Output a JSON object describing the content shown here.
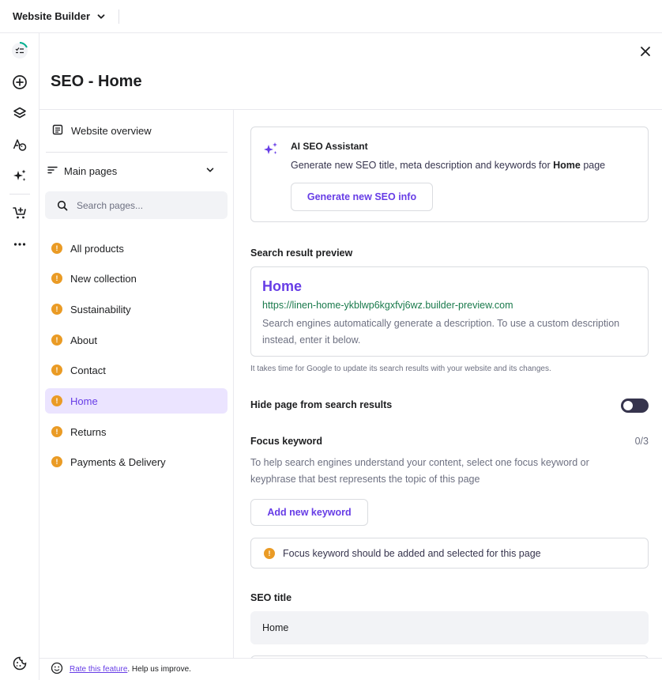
{
  "app": {
    "title": "Website Builder"
  },
  "rail": {
    "icons": [
      "checklist-progress-icon",
      "add-element-icon",
      "layers-icon",
      "typography-color-icon",
      "ai-tools-icon",
      "store-cart-icon",
      "more-icon",
      "cookie-settings-icon"
    ]
  },
  "panel": {
    "title": "SEO - Home",
    "close_icon": "close-icon"
  },
  "pages_nav": {
    "overview_label": "Website overview",
    "group_label": "Main pages",
    "search_placeholder": "Search pages...",
    "items": [
      {
        "label": "All products",
        "status": "warning"
      },
      {
        "label": "New collection",
        "status": "warning"
      },
      {
        "label": "Sustainability",
        "status": "warning"
      },
      {
        "label": "About",
        "status": "warning"
      },
      {
        "label": "Contact",
        "status": "warning"
      },
      {
        "label": "Home",
        "status": "warning",
        "active": true
      },
      {
        "label": "Returns",
        "status": "warning"
      },
      {
        "label": "Payments & Delivery",
        "status": "warning"
      }
    ],
    "warning_glyph": "!"
  },
  "ai_assistant": {
    "title": "AI SEO Assistant",
    "description_prefix": "Generate new SEO title, meta description and keywords for ",
    "description_page": "Home",
    "description_suffix": " page",
    "button_label": "Generate new SEO info"
  },
  "preview": {
    "section_label": "Search result preview",
    "title": "Home",
    "url": "https://linen-home-ykblwp6kgxfvj6wz.builder-preview.com",
    "description": "Search engines automatically generate a description. To use a custom description instead, enter it below.",
    "note": "It takes time for Google to update its search results with your website and its changes."
  },
  "hide_page": {
    "label": "Hide page from search results",
    "enabled": false
  },
  "focus_keyword": {
    "label": "Focus keyword",
    "counter": "0/3",
    "help": "To help search engines understand your content, select one focus keyword or keyphrase that best represents the topic of this page",
    "button_label": "Add new keyword",
    "alert": "Focus keyword should be added and selected for this page"
  },
  "seo_title": {
    "label": "SEO title",
    "value": "Home"
  },
  "footer": {
    "link_text": "Rate this feature",
    "rest_text": ". Help us improve."
  },
  "colors": {
    "accent": "#673de6",
    "warning": "#ea9b25",
    "url_green": "#1a7a4c",
    "active_bg": "#ebe4ff"
  }
}
